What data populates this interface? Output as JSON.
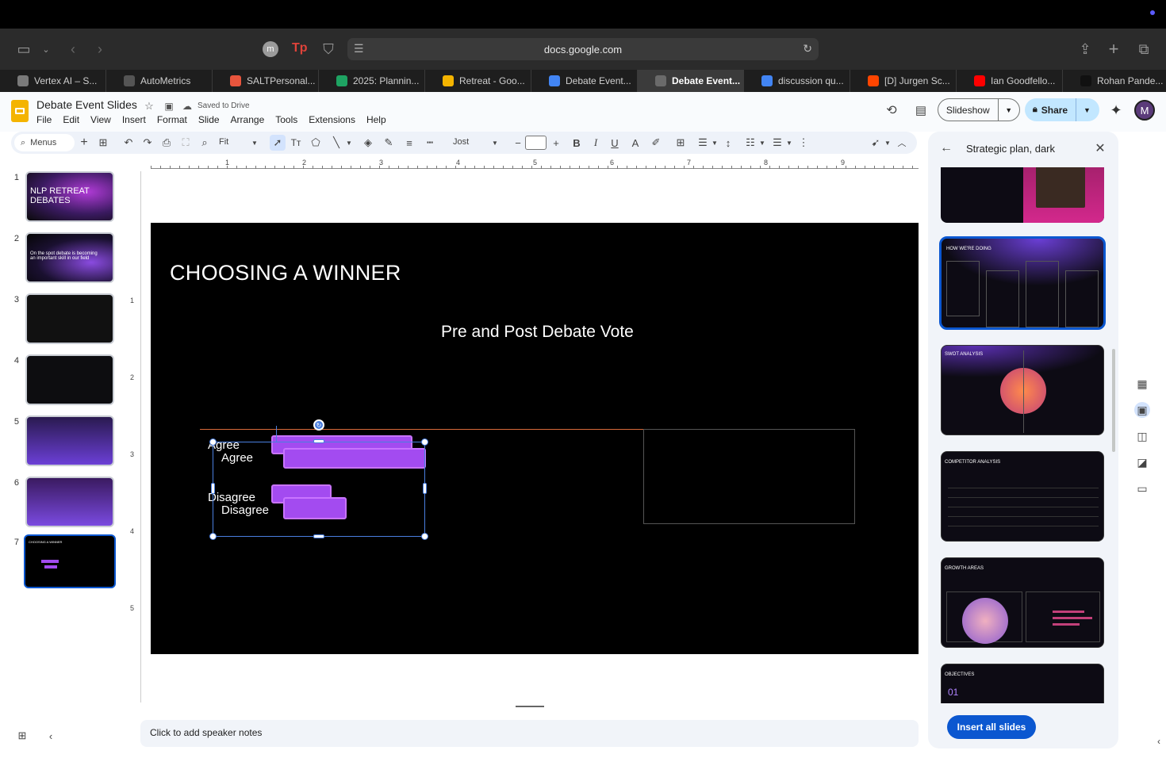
{
  "browser": {
    "url": "docs.google.com",
    "tabs": [
      {
        "label": "Vertex AI – S...",
        "color": "#7a7a7a"
      },
      {
        "label": "AutoMetrics",
        "color": "#555"
      },
      {
        "label": "SALTPersonal...",
        "color": "#e8553d"
      },
      {
        "label": "2025: Plannin...",
        "color": "#1ea362"
      },
      {
        "label": "Retreat - Goo...",
        "color": "#f4b400"
      },
      {
        "label": "Debate Event...",
        "color": "#4285f4"
      },
      {
        "label": "Debate Event...",
        "color": "#6a6a6a",
        "active": true
      },
      {
        "label": "discussion qu...",
        "color": "#4285f4"
      },
      {
        "label": "[D] Jurgen Sc...",
        "color": "#ff4500"
      },
      {
        "label": "Ian Goodfello...",
        "color": "#ff0000"
      },
      {
        "label": "Rohan Pande...",
        "color": "#111"
      }
    ]
  },
  "doc": {
    "title": "Debate Event Slides",
    "saved": "Saved to Drive",
    "menus": [
      "File",
      "Edit",
      "View",
      "Insert",
      "Format",
      "Slide",
      "Arrange",
      "Tools",
      "Extensions",
      "Help"
    ],
    "slideshow": "Slideshow",
    "share": "Share",
    "avatar": "M"
  },
  "toolbar": {
    "menus_label": "Menus",
    "zoom": "Fit",
    "font": "Jost"
  },
  "ruler": {
    "h": [
      "1",
      "2",
      "3",
      "4",
      "5",
      "6",
      "7",
      "8",
      "9"
    ],
    "v": [
      "1",
      "2",
      "3",
      "4",
      "5"
    ]
  },
  "filmstrip": [
    {
      "num": "1",
      "text": "NLP RETREAT DEBATES"
    },
    {
      "num": "2",
      "text": "On the spot debate is becoming an important skill in our field"
    },
    {
      "num": "3",
      "text": ""
    },
    {
      "num": "4",
      "text": ""
    },
    {
      "num": "5",
      "text": ""
    },
    {
      "num": "6",
      "text": ""
    },
    {
      "num": "7",
      "text": "CHOOSING A WINNER"
    }
  ],
  "slide": {
    "title": "CHOOSING A WINNER",
    "subtitle": "Pre and Post Debate Vote",
    "labels": {
      "agree1": "Agree",
      "agree2": "Agree",
      "disagree1": "Disagree",
      "disagree2": "Disagree"
    },
    "bar_color": "#a34bf0"
  },
  "notes": "Click to add speaker notes",
  "panel": {
    "title": "Strategic plan, dark",
    "insert_all": "Insert all slides",
    "templates": [
      {
        "title": "HOW WE'RE DOING"
      },
      {
        "title": "SWOT ANALYSIS"
      },
      {
        "title": "COMPETITOR ANALYSIS"
      },
      {
        "title": "GROWTH AREAS"
      },
      {
        "title": "OBJECTIVES",
        "num": "01"
      }
    ]
  }
}
